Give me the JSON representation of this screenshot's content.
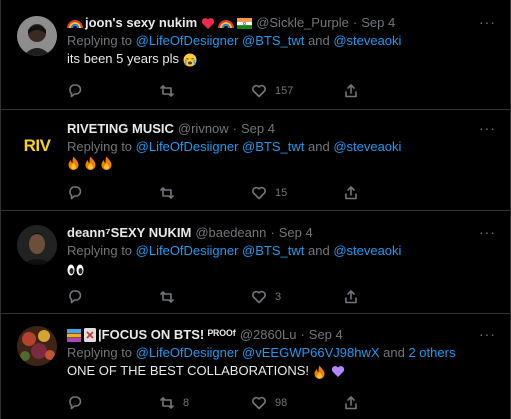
{
  "tweets": [
    {
      "name": "joon's sexy nukim",
      "handle": "@Sickle_Purple",
      "dot": "·",
      "date": "Sep 4",
      "reply_prefix": "Replying to ",
      "reply_mentions": "@LifeOfDesiigner @BTS_twt",
      "reply_and": " and ",
      "reply_last": "@steveaoki",
      "text": "its been 5 years pls",
      "replies": "",
      "retweets": "",
      "likes": "157",
      "avatar": "person-photo-icon"
    },
    {
      "name": "RIVETING MUSIC",
      "handle": "@rivnow",
      "dot": "·",
      "date": "Sep 4",
      "reply_prefix": "Replying to ",
      "reply_mentions": "@LifeOfDesiigner @BTS_twt",
      "reply_and": " and ",
      "reply_last": "@steveaoki",
      "text": "",
      "replies": "",
      "retweets": "",
      "likes": "15",
      "avatar_text": "RIV",
      "avatar_color": "#f5d21f"
    },
    {
      "name": "deann⁷SEXY NUKIM",
      "handle": "@baedeann",
      "dot": "·",
      "date": "Sep 4",
      "reply_prefix": "Replying to ",
      "reply_mentions": "@LifeOfDesiigner @BTS_twt",
      "reply_and": " and ",
      "reply_last": "@steveaoki",
      "text": "",
      "replies": "",
      "retweets": "",
      "likes": "3",
      "avatar": "person-photo-icon"
    },
    {
      "name": "|FOCUS ON BTS! ᴾᴿᴼᴼᶠ",
      "handle": "@2860Lu",
      "dot": "·",
      "date": "Sep 4",
      "reply_prefix": "Replying to ",
      "reply_mentions": "@LifeOfDesiigner @vEEGWP66VJ98hwX",
      "reply_and": " and ",
      "reply_last": "2 others",
      "text": "ONE OF THE BEST COLLABORATIONS!",
      "replies": "",
      "retweets": "8",
      "likes": "98",
      "avatar": "flowers-photo-icon"
    }
  ],
  "more_label": "···",
  "colors": {
    "accent": "#1d9bf0",
    "muted": "#71767b",
    "text": "#e7e9ea",
    "border": "#2f3336"
  }
}
